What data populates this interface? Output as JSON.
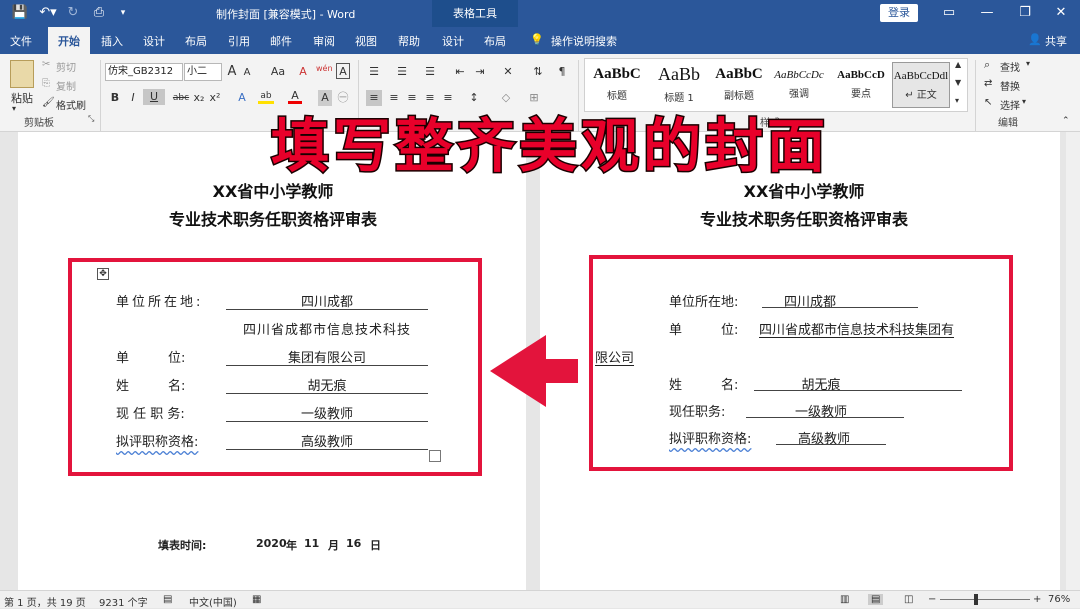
{
  "window": {
    "title": "制作封面 [兼容模式] - Word",
    "context_tab_header": "表格工具",
    "login_button": "登录",
    "share_button": "共享"
  },
  "tabs": [
    "文件",
    "开始",
    "插入",
    "设计",
    "布局",
    "引用",
    "邮件",
    "审阅",
    "视图",
    "帮助",
    "设计",
    "布局"
  ],
  "tell_me": "操作说明搜索",
  "ribbon": {
    "clipboard": {
      "paste": "粘贴",
      "cut": "剪切",
      "copy": "复制",
      "format_painter": "格式刷",
      "group": "剪贴板"
    },
    "font": {
      "font_name": "仿宋_GB2312",
      "font_size": "小二",
      "grow": "A",
      "shrink": "A",
      "case": "Aa",
      "clear": "A",
      "phonetic": "wén",
      "border": "A",
      "bold": "B",
      "italic": "I",
      "underline": "U",
      "strike": "abc",
      "sub": "x₂",
      "sup": "x²",
      "effects": "A",
      "highlight": "ab",
      "color": "A",
      "shading": "A"
    },
    "styles": [
      {
        "sample": "AaBbC",
        "name": "标题"
      },
      {
        "sample": "AaBb",
        "name": "标题 1"
      },
      {
        "sample": "AaBbC",
        "name": "副标题"
      },
      {
        "sample": "AaBbCcDc",
        "name": "强调"
      },
      {
        "sample": "AaBbCcD",
        "name": "要点"
      },
      {
        "sample": "AaBbCcDdl",
        "name": "↵ 正文"
      }
    ],
    "styles_group": "样式",
    "editing": {
      "find": "查找",
      "replace": "替换",
      "select": "选择",
      "group": "编辑"
    }
  },
  "banner": "填写整齐美观的封面",
  "left_page": {
    "title1": "XX省中小学教师",
    "title2": "专业技术职务任职资格评审表",
    "fields": [
      {
        "label": "单位所在地:",
        "value": "四川成都"
      },
      {
        "label": "",
        "value": "四川省成都市信息技术科技"
      },
      {
        "label": "单　　　位:",
        "value": "集团有限公司"
      },
      {
        "label": "姓　　　名:",
        "value": "胡无痕"
      },
      {
        "label": "现 任 职 务:",
        "value": "一级教师"
      },
      {
        "label": "拟评职称资格:",
        "value": "高级教师"
      }
    ],
    "fill_time_label": "填表时间:",
    "fill_year": "2020",
    "year_unit": "年",
    "fill_month": "11",
    "month_unit": "月",
    "fill_day": "16",
    "day_unit": "日"
  },
  "right_page": {
    "title1": "XX省中小学教师",
    "title2": "专业技术职务任职资格评审表",
    "row1_label": "单位所在地:",
    "row1_value": "四川成都",
    "row2_label": "单　　　位:",
    "row2_value": "四川省成都市信息技术科技集团有",
    "row2_wrap": "限公司",
    "row3_label": "姓　　　名:",
    "row3_value": "胡无痕",
    "row4_label": "现任职务:",
    "row4_value": "一级教师",
    "row5_label": "拟评职称资格:",
    "row5_value": "高级教师"
  },
  "status": {
    "page": "第 1 页，共 19 页",
    "words": "9231 个字",
    "lang": "中文(中国)",
    "zoom": "76%"
  },
  "colors": {
    "accent": "#2b579a",
    "highlight_box": "#e3143c",
    "banner_text": "#e8002a"
  }
}
